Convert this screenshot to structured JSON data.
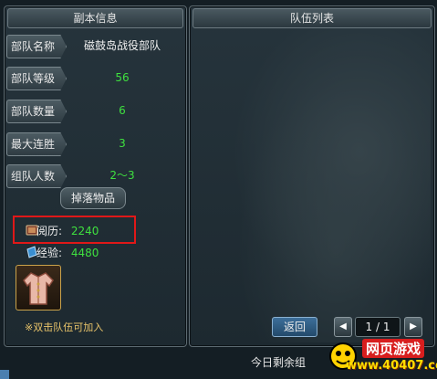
{
  "left_panel": {
    "title": "副本信息",
    "rows": [
      {
        "label": "部队名称",
        "value": "磁鼓岛战役部队"
      },
      {
        "label": "部队等级",
        "value": "56"
      },
      {
        "label": "部队数量",
        "value": "6"
      },
      {
        "label": "最大连胜",
        "value": "3"
      },
      {
        "label": "组队人数",
        "value": "2～3"
      }
    ],
    "drop_button": "掉落物品",
    "loot": [
      {
        "name": "阅历:",
        "value": "2240",
        "icon": "book-icon"
      },
      {
        "name": "经验:",
        "value": "4480",
        "icon": "scroll-icon"
      }
    ],
    "item_icon": "clothing-icon",
    "hint": "※双击队伍可加入"
  },
  "right_panel": {
    "title": "队伍列表",
    "back_button": "返回",
    "page_indicator": "1 / 1",
    "prev_icon": "left-arrow-icon",
    "next_icon": "right-arrow-icon"
  },
  "footer": {
    "text": "今日剩余组"
  },
  "watermark": {
    "line1": "网页游戏",
    "line2": "www.40407.com"
  },
  "colors": {
    "green_value": "#3fe03f",
    "highlight_box": "#e01818"
  }
}
